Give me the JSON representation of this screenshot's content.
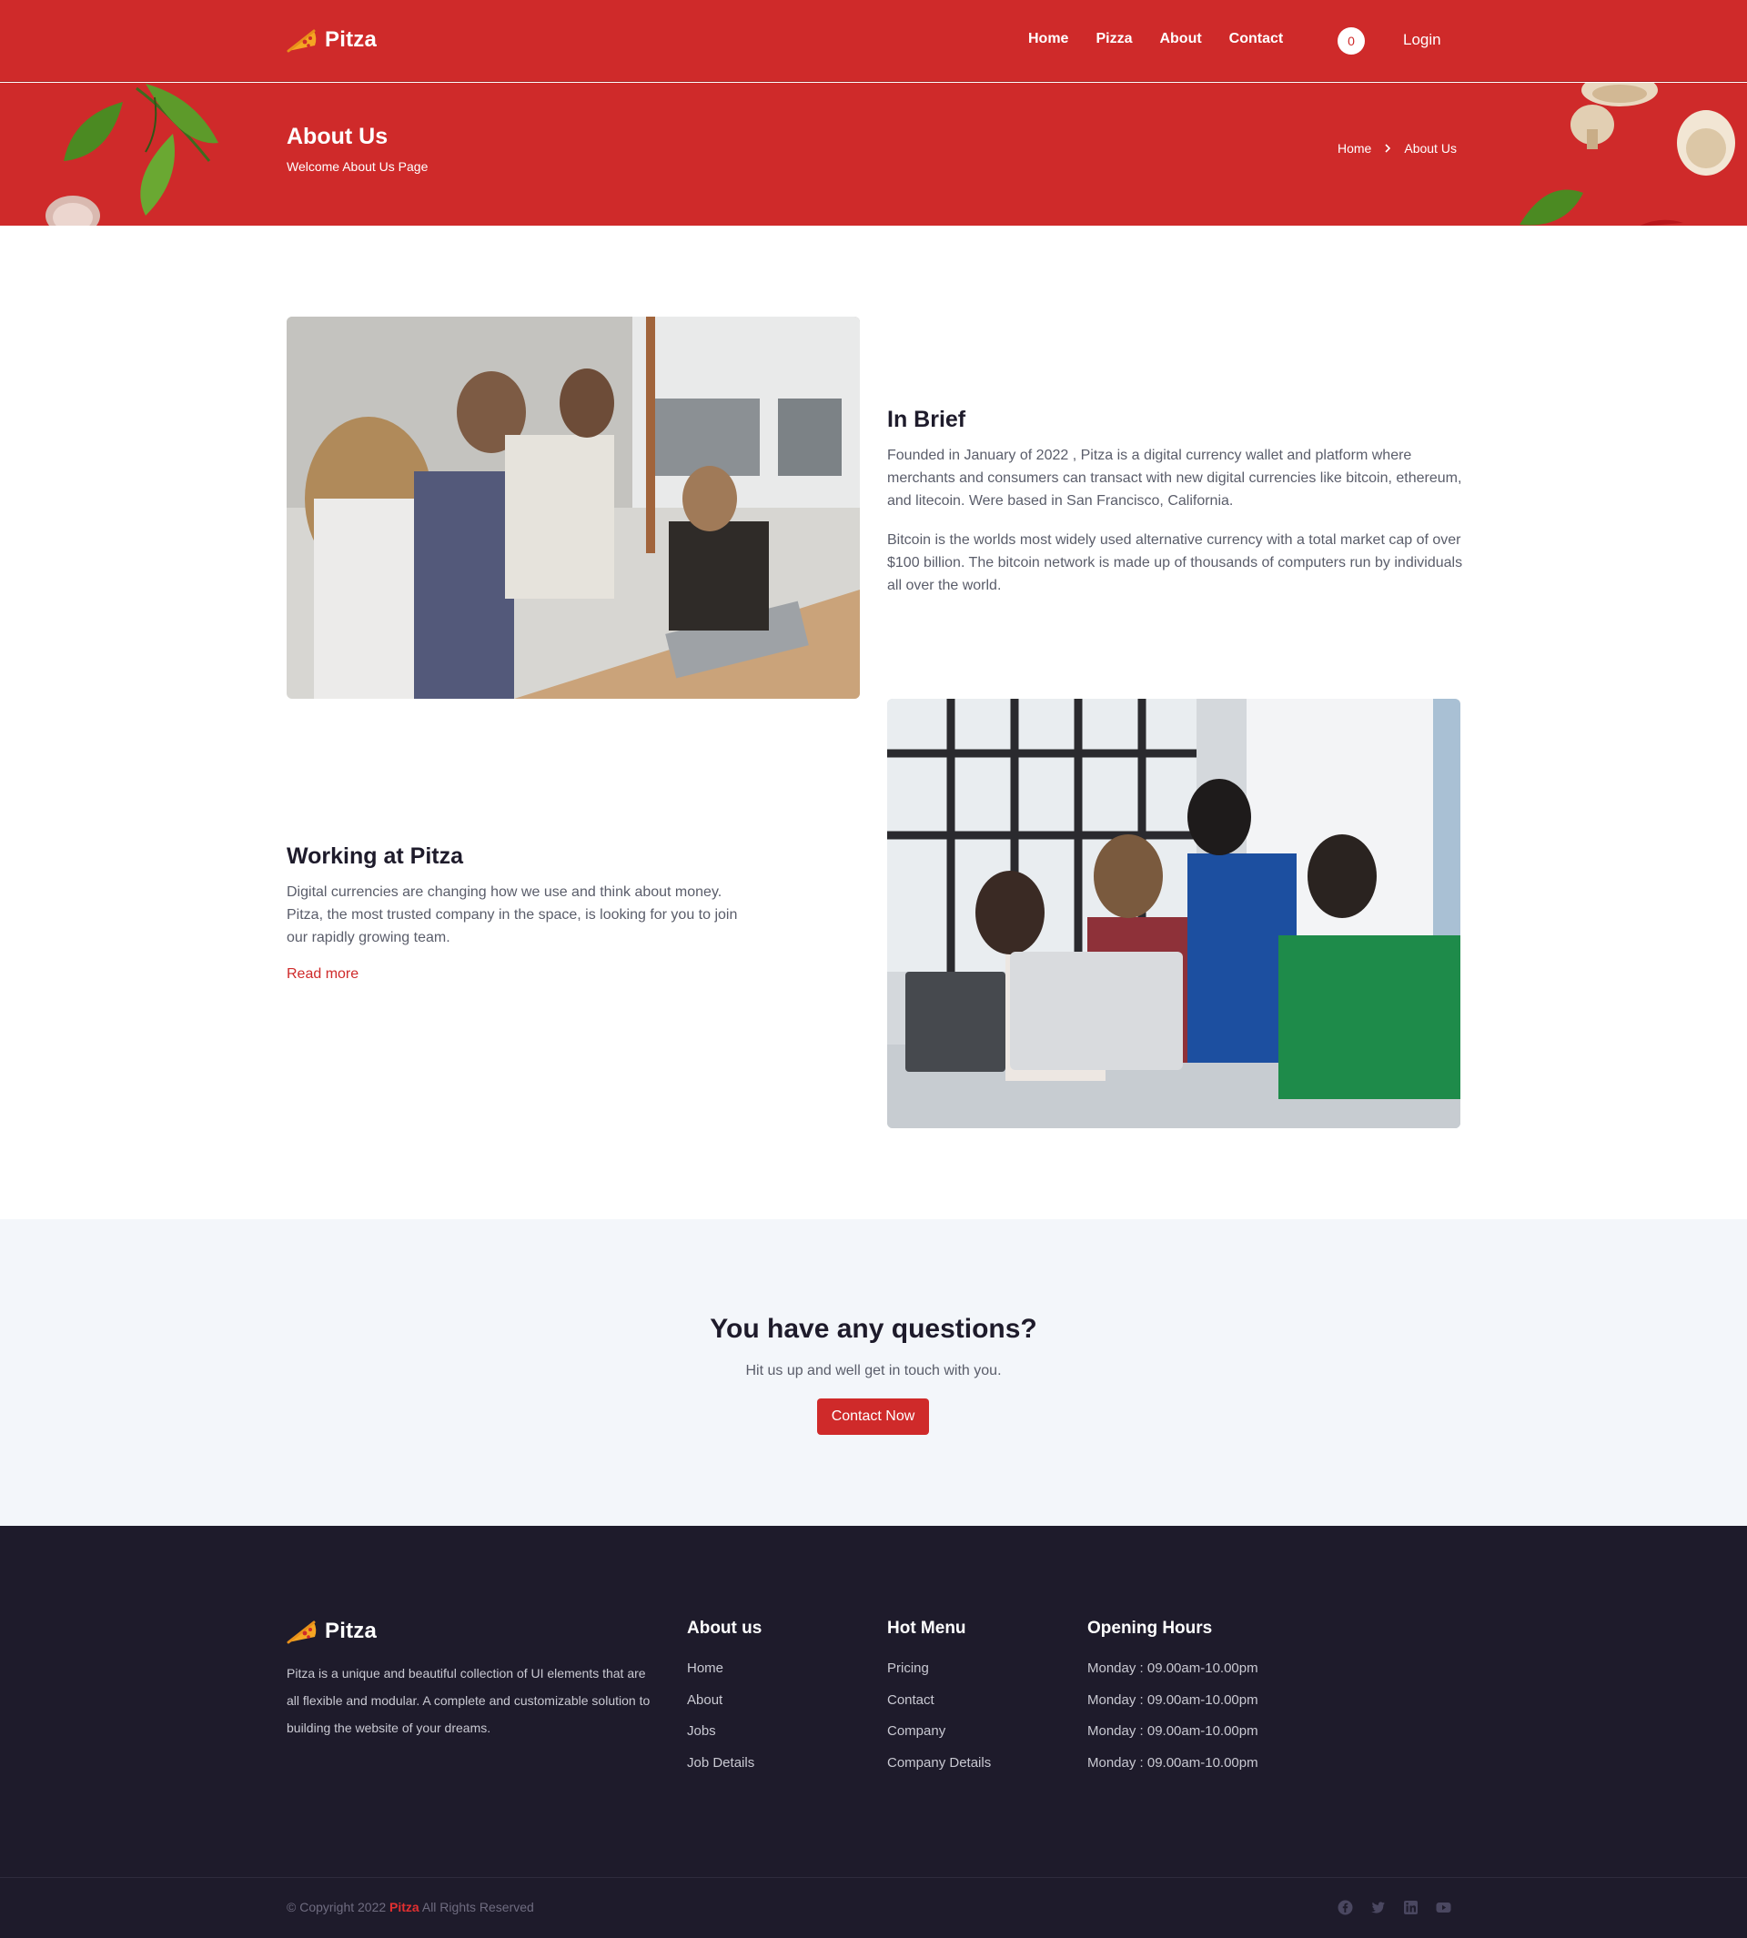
{
  "colors": {
    "brand": "#cf2a2a",
    "dark": "#1e1b2b",
    "light_bg": "#f3f6fa"
  },
  "header": {
    "logo_text": "Pitza",
    "nav": [
      "Home",
      "Pizza",
      "About",
      "Contact"
    ],
    "cart_count": "0",
    "login_label": "Login"
  },
  "page_header": {
    "title": "About Us",
    "subtitle": "Welcome About Us Page",
    "breadcrumb": [
      "Home",
      "About Us"
    ]
  },
  "about": {
    "in_brief": {
      "title": "In Brief",
      "paragraphs": [
        "Founded in January of 2022 , Pitza is a digital currency wallet and platform where merchants and consumers can transact with new digital currencies like bitcoin, ethereum, and litecoin. Were based in San Francisco, California.",
        "Bitcoin is the worlds most widely used alternative currency with a total market cap of over $100 billion. The bitcoin network is made up of thousands of computers run by individuals all over the world."
      ]
    },
    "working": {
      "title": "Working at Pitza",
      "paragraph": "Digital currencies are changing how we use and think about money. Pitza, the most trusted company in the space, is looking for you to join our rapidly growing team.",
      "link_label": "Read more"
    }
  },
  "cta": {
    "title": "You have any questions?",
    "subtitle": "Hit us up and well get in touch with you.",
    "button_label": "Contact Now"
  },
  "footer": {
    "logo_text": "Pitza",
    "description": "Pitza is a unique and beautiful collection of UI elements that are all flexible and modular. A complete and customizable solution to building the website of your dreams.",
    "columns": [
      {
        "title": "About us",
        "items": [
          "Home",
          "About",
          "Jobs",
          "Job Details"
        ]
      },
      {
        "title": "Hot Menu",
        "items": [
          "Pricing",
          "Contact",
          "Company",
          "Company Details"
        ]
      },
      {
        "title": "Opening Hours",
        "items": [
          "Monday : 09.00am-10.00pm",
          "Monday : 09.00am-10.00pm",
          "Monday : 09.00am-10.00pm",
          "Monday : 09.00am-10.00pm"
        ]
      }
    ],
    "copyright_prefix": "© Copyright 2022",
    "copyright_brand": "Pitza",
    "copyright_suffix": "All Rights Reserved",
    "socials": [
      "facebook-icon",
      "twitter-icon",
      "linkedin-icon",
      "youtube-icon"
    ]
  }
}
